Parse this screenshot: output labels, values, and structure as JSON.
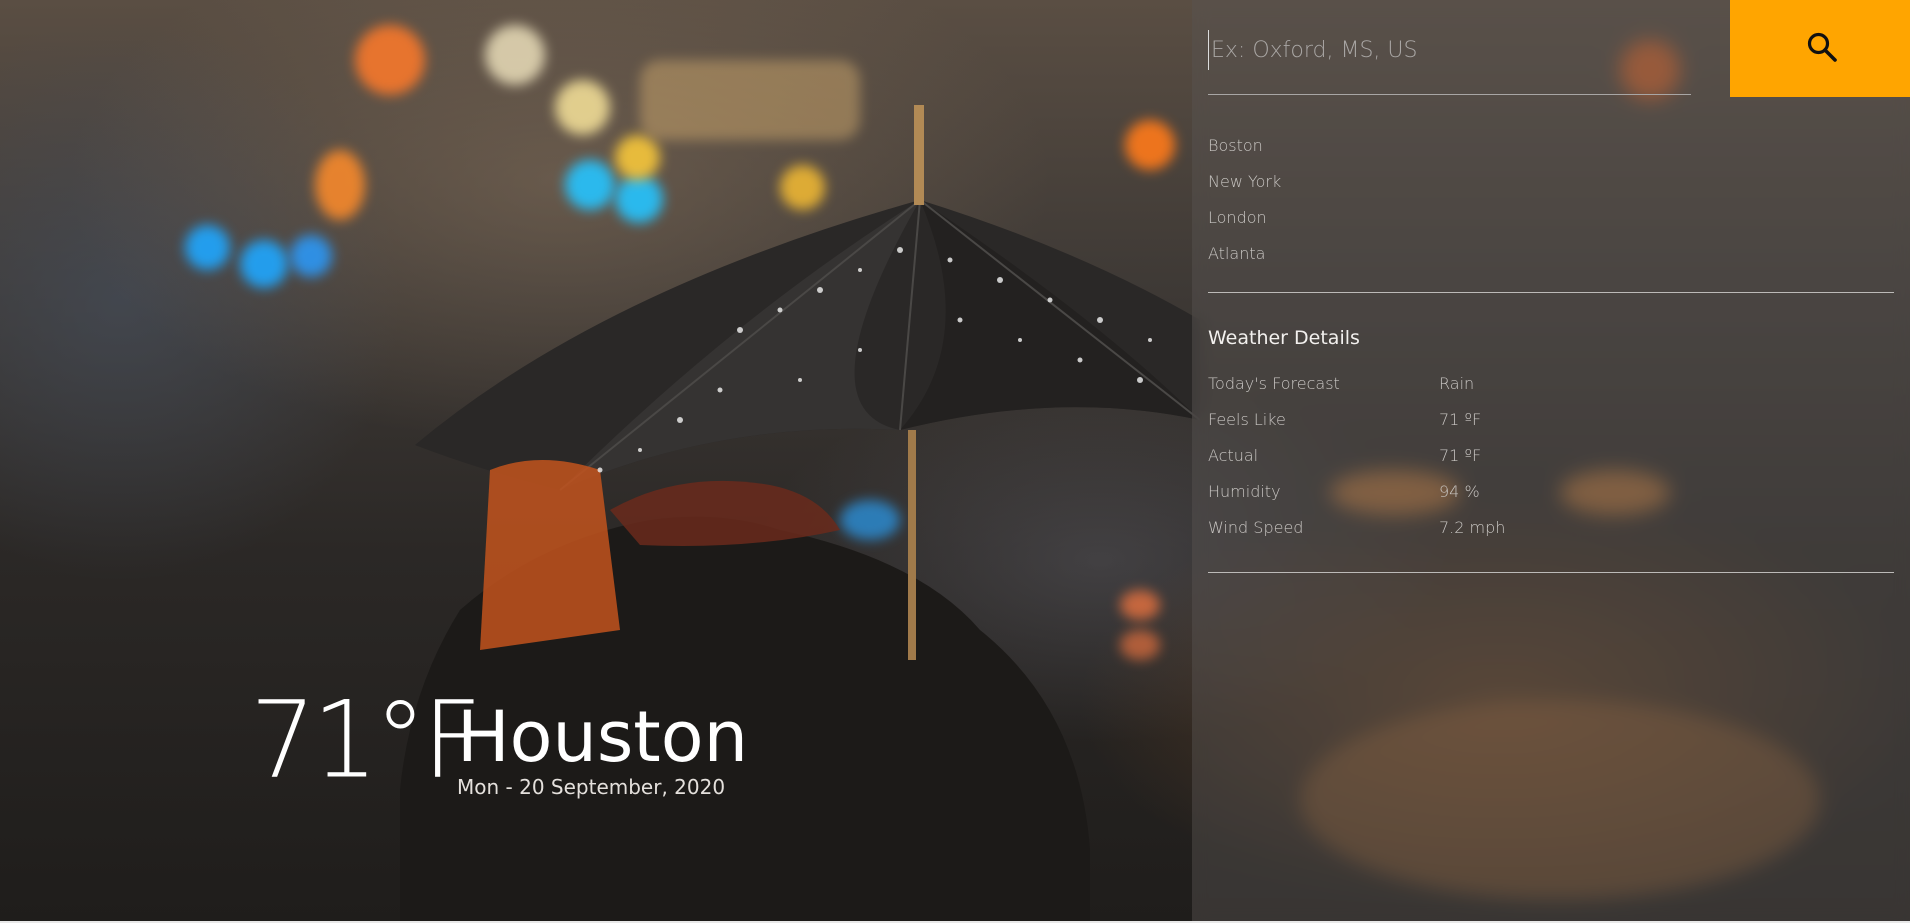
{
  "colors": {
    "accent": "#ffa500",
    "text_primary": "#ffffff",
    "text_secondary": "#c9c6c3",
    "panel_background": "rgba(88,84,82,0.45)"
  },
  "current": {
    "temperature": "71°F",
    "city": "Houston",
    "date": "Mon - 20 September, 2020"
  },
  "search": {
    "placeholder": "Ex: Oxford, MS, US",
    "value": "",
    "button_icon": "search-icon"
  },
  "recent_cities": [
    "Boston",
    "New York",
    "London",
    "Atlanta"
  ],
  "details": {
    "title": "Weather Details",
    "rows": [
      {
        "label": "Today's Forecast",
        "value": "Rain"
      },
      {
        "label": "Feels Like",
        "value": "71 ºF"
      },
      {
        "label": "Actual",
        "value": "71 ºF"
      },
      {
        "label": "Humidity",
        "value": "94 %"
      },
      {
        "label": "Wind Speed",
        "value": "7.2 mph"
      }
    ]
  }
}
